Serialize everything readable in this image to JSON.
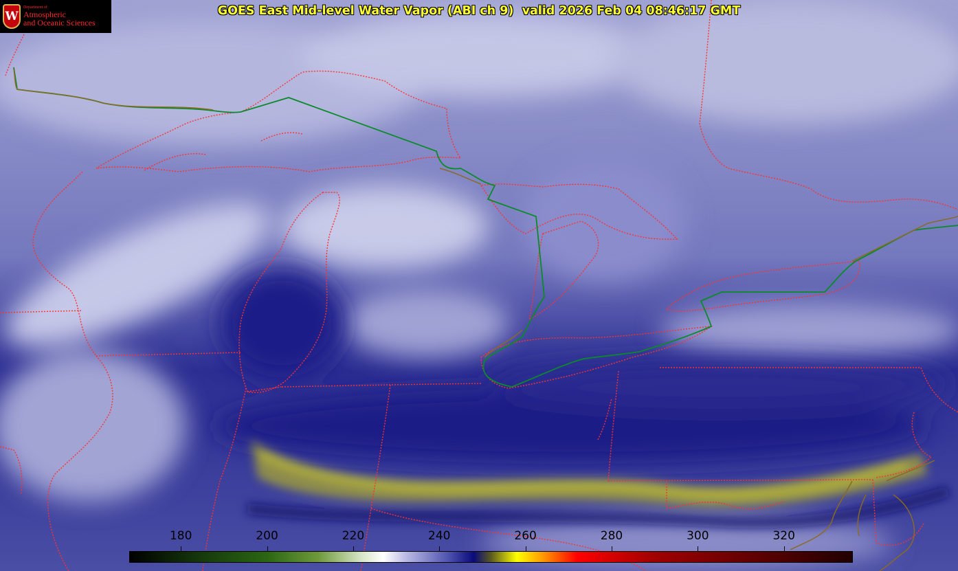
{
  "title": "GOES East Mid-level Water Vapor (ABI ch 9)  valid 2026 Feb 04 08:46:17 GMT",
  "logo": {
    "small_text": "Department of",
    "line1": "Atmospheric",
    "line2": "and Oceanic Sciences",
    "crest_letter": "W",
    "crest_color": "#c5050c"
  },
  "colors": {
    "background": "#3b3f98",
    "boundary_red": "#ff3030",
    "border_green": "#0b8a2a",
    "coast_olive": "#7a6a1a",
    "moisture_yellow": "#c8c832",
    "title_yellow": "#ffff33"
  },
  "colorbar": {
    "unit_hint": "brightness temperature",
    "min": 168,
    "max": 336,
    "ticks": [
      "180",
      "200",
      "220",
      "240",
      "260",
      "280",
      "300",
      "320"
    ],
    "tick_values": [
      180,
      200,
      220,
      240,
      260,
      280,
      300,
      320
    ],
    "stops": [
      {
        "v": 168,
        "c": "#000000"
      },
      {
        "v": 185,
        "c": "#163a0c"
      },
      {
        "v": 200,
        "c": "#2b6614"
      },
      {
        "v": 212,
        "c": "#6f9a3c"
      },
      {
        "v": 222,
        "c": "#d8e6c8"
      },
      {
        "v": 227,
        "c": "#ffffff"
      },
      {
        "v": 232,
        "c": "#bdbde6"
      },
      {
        "v": 242,
        "c": "#5054b0"
      },
      {
        "v": 248,
        "c": "#0a0a7a"
      },
      {
        "v": 252,
        "c": "#5a5a20"
      },
      {
        "v": 258,
        "c": "#ffff00"
      },
      {
        "v": 264,
        "c": "#ff9a00"
      },
      {
        "v": 272,
        "c": "#ff0000"
      },
      {
        "v": 290,
        "c": "#a00000"
      },
      {
        "v": 336,
        "c": "#200000"
      }
    ]
  }
}
